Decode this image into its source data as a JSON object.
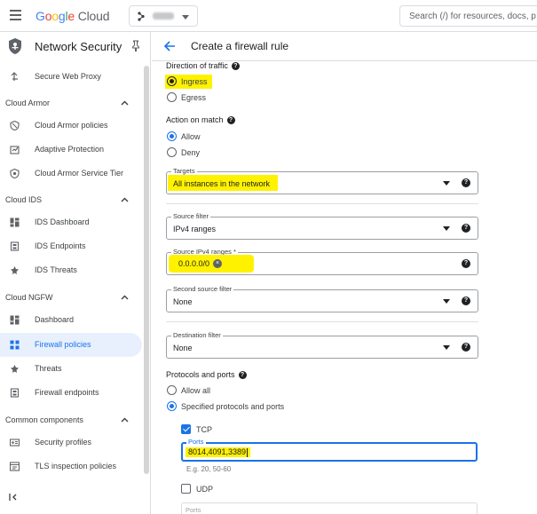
{
  "topbar": {
    "logo_parts": [
      "G",
      "o",
      "o",
      "g",
      "l",
      "e"
    ],
    "logo_product": "Cloud",
    "search_placeholder": "Search (/) for resources, docs, p"
  },
  "sidebar": {
    "title": "Network Security",
    "items": [
      {
        "type": "item",
        "label": "Secure Web Proxy",
        "icon": "proxy-icon"
      },
      {
        "type": "section",
        "label": "Cloud Armor"
      },
      {
        "type": "item",
        "label": "Cloud Armor policies",
        "icon": "armor-shield-icon"
      },
      {
        "type": "item",
        "label": "Adaptive Protection",
        "icon": "adaptive-protection-icon"
      },
      {
        "type": "item",
        "label": "Cloud Armor Service Tier",
        "icon": "service-tier-icon"
      },
      {
        "type": "section",
        "label": "Cloud IDS"
      },
      {
        "type": "item",
        "label": "IDS Dashboard",
        "icon": "dashboard-icon"
      },
      {
        "type": "item",
        "label": "IDS Endpoints",
        "icon": "endpoint-icon"
      },
      {
        "type": "item",
        "label": "IDS Threats",
        "icon": "threat-icon"
      },
      {
        "type": "section",
        "label": "Cloud NGFW"
      },
      {
        "type": "item",
        "label": "Dashboard",
        "icon": "dashboard-icon"
      },
      {
        "type": "item",
        "label": "Firewall policies",
        "icon": "firewall-policies-icon",
        "active": true
      },
      {
        "type": "item",
        "label": "Threats",
        "icon": "threat-icon"
      },
      {
        "type": "item",
        "label": "Firewall endpoints",
        "icon": "endpoint-icon"
      },
      {
        "type": "section",
        "label": "Common components"
      },
      {
        "type": "item",
        "label": "Security profiles",
        "icon": "security-profile-icon"
      },
      {
        "type": "item",
        "label": "TLS inspection policies",
        "icon": "tls-icon"
      }
    ]
  },
  "main": {
    "title": "Create a firewall rule",
    "direction": {
      "title": "Direction of traffic",
      "options": [
        "Ingress",
        "Egress"
      ],
      "selected": "Ingress"
    },
    "action": {
      "title": "Action on match",
      "options": [
        "Allow",
        "Deny"
      ],
      "selected": "Allow"
    },
    "targets": {
      "label": "Targets",
      "value": "All instances in the network"
    },
    "source_filter": {
      "label": "Source filter",
      "value": "IPv4 ranges"
    },
    "source_ranges": {
      "label": "Source IPv4 ranges *",
      "chip": "0.0.0.0/0",
      "chip_remove": "×"
    },
    "second_source_filter": {
      "label": "Second source filter",
      "value": "None"
    },
    "destination_filter": {
      "label": "Destination filter",
      "value": "None"
    },
    "protocols": {
      "title": "Protocols and ports",
      "options": [
        "Allow all",
        "Specified protocols and ports"
      ],
      "selected": "Specified protocols and ports",
      "tcp": {
        "label": "TCP",
        "checked": true,
        "ports_label": "Ports",
        "ports_value": "8014,4091,3389",
        "hint": "E.g. 20, 50-60"
      },
      "udp": {
        "label": "UDP",
        "checked": false,
        "ports_label": "Ports"
      }
    }
  },
  "colors": {
    "accent": "#1a73e8",
    "highlight": "#fff200"
  }
}
